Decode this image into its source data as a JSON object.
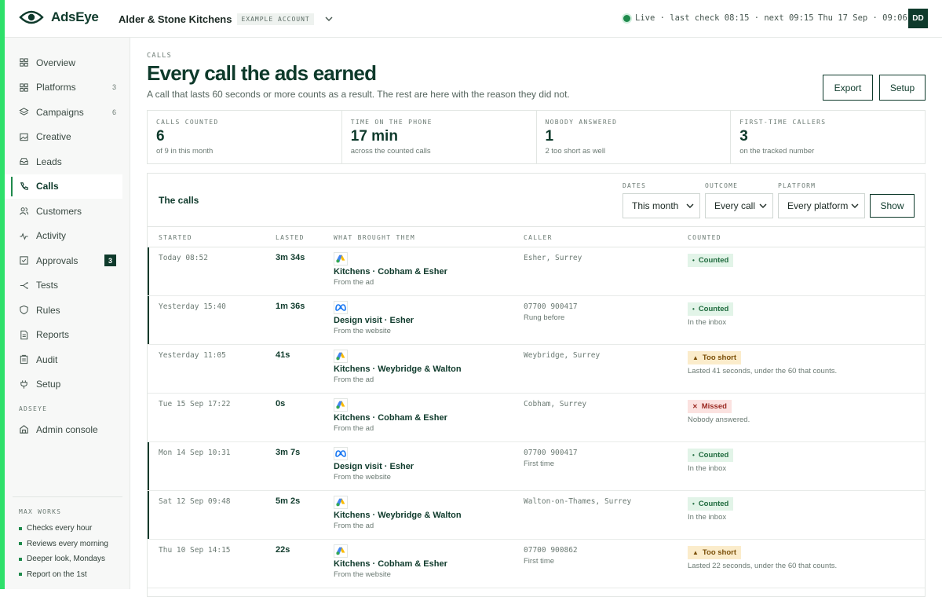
{
  "app": {
    "name": "AdsEye",
    "account": "Alder & Stone Kitchens",
    "account_tag": "EXAMPLE ACCOUNT",
    "status": "Live · last check 08:15 · next 09:15",
    "datetime": "Thu 17 Sep · 09:06",
    "avatar": "DD"
  },
  "sidebar": {
    "items": [
      {
        "label": "Overview",
        "count": "",
        "icon": "grid-icon"
      },
      {
        "label": "Platforms",
        "count": "3",
        "icon": "platforms-icon"
      },
      {
        "label": "Campaigns",
        "count": "6",
        "icon": "layers-icon"
      },
      {
        "label": "Creative",
        "count": "",
        "icon": "image-icon"
      },
      {
        "label": "Leads",
        "count": "",
        "icon": "inbox-icon"
      },
      {
        "label": "Calls",
        "count": "",
        "icon": "phone-icon"
      },
      {
        "label": "Customers",
        "count": "",
        "icon": "users-icon"
      },
      {
        "label": "Activity",
        "count": "",
        "icon": "activity-icon"
      },
      {
        "label": "Approvals",
        "count": "3",
        "icon": "check-square-icon"
      },
      {
        "label": "Tests",
        "count": "",
        "icon": "split-icon"
      },
      {
        "label": "Rules",
        "count": "",
        "icon": "shield-icon"
      },
      {
        "label": "Reports",
        "count": "",
        "icon": "document-icon"
      },
      {
        "label": "Audit",
        "count": "",
        "icon": "clipboard-icon"
      },
      {
        "label": "Setup",
        "count": "",
        "icon": "plug-icon"
      }
    ],
    "section_label": "ADSEYE",
    "admin_label": "Admin console",
    "works_label": "MAX WORKS",
    "works": [
      "Checks every hour",
      "Reviews every morning",
      "Deeper look, Mondays",
      "Report on the 1st"
    ]
  },
  "page": {
    "eyebrow": "CALLS",
    "title": "Every call the ads earned",
    "subtitle": "A call that lasts 60 seconds or more counts as a result. The rest are here with the reason they did not.",
    "export_label": "Export",
    "setup_label": "Setup"
  },
  "stats": [
    {
      "label": "CALLS COUNTED",
      "value": "6",
      "sub": "of 9 in this month"
    },
    {
      "label": "TIME ON THE PHONE",
      "value": "17 min",
      "sub": "across the counted calls"
    },
    {
      "label": "NOBODY ANSWERED",
      "value": "1",
      "sub": "2 too short as well"
    },
    {
      "label": "FIRST-TIME CALLERS",
      "value": "3",
      "sub": "on the tracked number"
    }
  ],
  "calls": {
    "title": "The calls",
    "filters": {
      "dates_label": "DATES",
      "dates_value": "This month",
      "outcome_label": "OUTCOME",
      "outcome_value": "Every call",
      "platform_label": "PLATFORM",
      "platform_value": "Every platform",
      "show_label": "Show"
    },
    "columns": [
      "STARTED",
      "LASTED",
      "WHAT BROUGHT THEM",
      "CALLER",
      "COUNTED"
    ],
    "rows": [
      {
        "started": "Today 08:52",
        "lasted": "3m 34s",
        "platform": "google",
        "campaign": "Kitchens · Cobham & Esher",
        "via": "From the ad",
        "caller": "Esher, Surrey",
        "caller_note": "",
        "status": "Counted",
        "status_kind": "ok",
        "note": ""
      },
      {
        "started": "Yesterday 15:40",
        "lasted": "1m 36s",
        "platform": "meta",
        "campaign": "Design visit · Esher",
        "via": "From the website",
        "caller": "07700 900417",
        "caller_note": "Rung before",
        "status": "Counted",
        "status_kind": "ok",
        "note": "In the inbox"
      },
      {
        "started": "Yesterday 11:05",
        "lasted": "41s",
        "platform": "google",
        "campaign": "Kitchens · Weybridge & Walton",
        "via": "From the ad",
        "caller": "Weybridge, Surrey",
        "caller_note": "",
        "status": "Too short",
        "status_kind": "short",
        "note": "Lasted 41 seconds, under the 60 that counts."
      },
      {
        "started": "Tue 15 Sep 17:22",
        "lasted": "0s",
        "platform": "google",
        "campaign": "Kitchens · Cobham & Esher",
        "via": "From the ad",
        "caller": "Cobham, Surrey",
        "caller_note": "",
        "status": "Missed",
        "status_kind": "missed",
        "note": "Nobody answered."
      },
      {
        "started": "Mon 14 Sep 10:31",
        "lasted": "3m 7s",
        "platform": "meta",
        "campaign": "Design visit · Esher",
        "via": "From the website",
        "caller": "07700 900417",
        "caller_note": "First time",
        "status": "Counted",
        "status_kind": "ok",
        "note": "In the inbox"
      },
      {
        "started": "Sat 12 Sep 09:48",
        "lasted": "5m 2s",
        "platform": "google",
        "campaign": "Kitchens · Weybridge & Walton",
        "via": "From the ad",
        "caller": "Walton-on-Thames, Surrey",
        "caller_note": "",
        "status": "Counted",
        "status_kind": "ok",
        "note": "In the inbox"
      },
      {
        "started": "Thu 10 Sep 14:15",
        "lasted": "22s",
        "platform": "google",
        "campaign": "Kitchens · Cobham & Esher",
        "via": "From the website",
        "caller": "07700 900862",
        "caller_note": "First time",
        "status": "Too short",
        "status_kind": "short",
        "note": "Lasted 22 seconds, under the 60 that counts."
      }
    ]
  },
  "colors": {
    "brand": "#0e3a2b",
    "accent": "#2ee06a",
    "ok": "#1f6b3e",
    "warn": "#7a4e07",
    "danger": "#9b2a22"
  }
}
